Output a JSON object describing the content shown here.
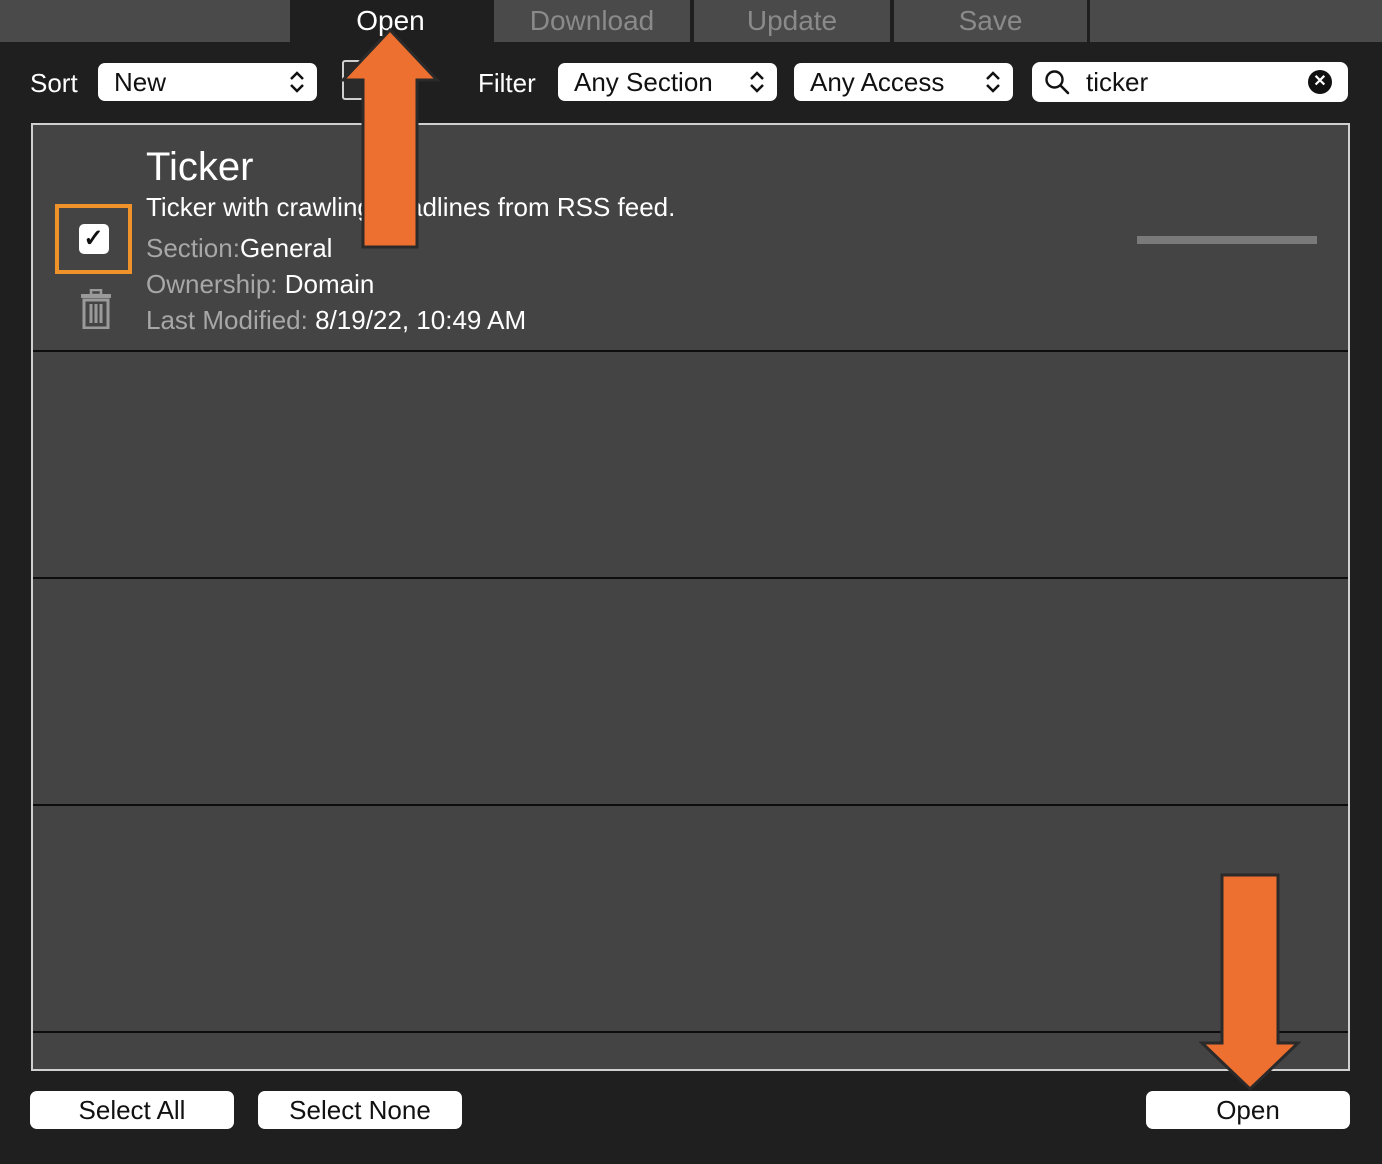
{
  "tabs": [
    {
      "label": "Open",
      "active": true
    },
    {
      "label": "Download",
      "active": false
    },
    {
      "label": "Update",
      "active": false
    },
    {
      "label": "Save",
      "active": false
    }
  ],
  "toolbar": {
    "sort_label": "Sort",
    "sort_value": "New",
    "filter_label": "Filter",
    "section_value": "Any Section",
    "access_value": "Any Access",
    "search_value": "ticker"
  },
  "items": [
    {
      "title": "Ticker",
      "description": "Ticker with crawling headlines from RSS feed.",
      "section_key": "Section:",
      "section_value": "General",
      "ownership_key": "Ownership:",
      "ownership_value": "Domain",
      "modified_key": "Last Modified:",
      "modified_value": "8/19/22, 10:49 AM",
      "selected": true
    }
  ],
  "footer": {
    "select_all_label": "Select All",
    "select_none_label": "Select None",
    "open_label": "Open"
  },
  "colors": {
    "highlight": "#f0922a",
    "arrow": "#ed7030",
    "tab_inactive": "#4a4a4a",
    "list_bg": "#444444"
  },
  "icons": {
    "search": "magnifier-icon",
    "clear": "clear-x-icon",
    "trash": "trash-icon",
    "chevron": "updown-chevron-icon",
    "checkbox": "checkmark-icon"
  }
}
